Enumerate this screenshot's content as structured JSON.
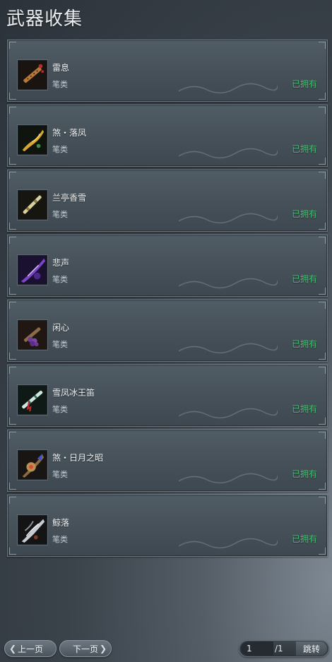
{
  "page_title": "武器收集",
  "items": [
    {
      "name": "雷息",
      "category": "笔类",
      "status": "已拥有",
      "icon": "flute-weapon-icon"
    },
    {
      "name": "煞・落凤",
      "category": "笔类",
      "status": "已拥有",
      "icon": "golden-brush-icon"
    },
    {
      "name": "兰亭香雪",
      "category": "笔类",
      "status": "已拥有",
      "icon": "jade-brush-icon"
    },
    {
      "name": "悲声",
      "category": "笔类",
      "status": "已拥有",
      "icon": "purple-brush-icon"
    },
    {
      "name": "闲心",
      "category": "笔类",
      "status": "已拥有",
      "icon": "grape-brush-icon"
    },
    {
      "name": "雪凤冰王笛",
      "category": "笔类",
      "status": "已拥有",
      "icon": "ice-flute-icon"
    },
    {
      "name": "煞・日月之昭",
      "category": "笔类",
      "status": "已拥有",
      "icon": "sun-moon-brush-icon"
    },
    {
      "name": "鲸落",
      "category": "笔类",
      "status": "已拥有",
      "icon": "silver-brush-icon"
    }
  ],
  "pager": {
    "prev_label": "上一页",
    "next_label": "下一页",
    "current_page": "1",
    "total_pages": "/1",
    "jump_label": "跳转"
  },
  "colors": {
    "owned": "#3dc66d",
    "card_border": "#6e7b84"
  }
}
